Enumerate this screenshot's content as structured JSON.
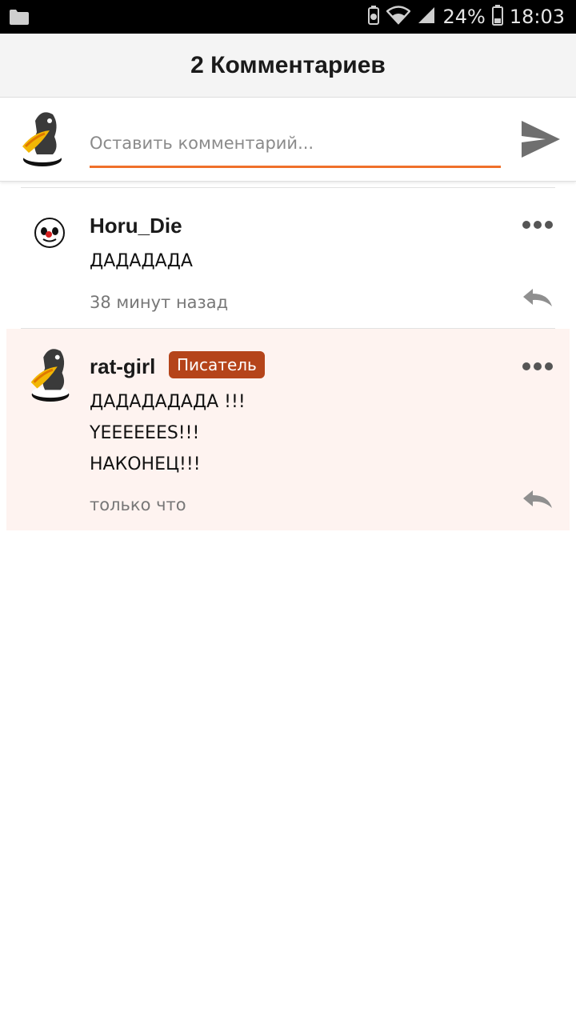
{
  "status_bar": {
    "battery_percent": "24%",
    "time": "18:03"
  },
  "header": {
    "title": "2 Комментариев"
  },
  "compose": {
    "placeholder": "Оставить комментарий...",
    "accent_color": "#f0702a"
  },
  "comments": [
    {
      "author": "Horu_Die",
      "badge": "",
      "lines": [
        "ДАДАДАДА"
      ],
      "time": "38 минут назад"
    },
    {
      "author": "rat-girl",
      "badge": "Писатель",
      "lines": [
        "ДАДАДАДАДА !!!",
        "YEEEEEES!!!",
        "НАКОНЕЦ!!!"
      ],
      "time": "только что"
    }
  ],
  "colors": {
    "badge_bg": "#b5441a",
    "highlight_bg": "#fef3f0"
  }
}
